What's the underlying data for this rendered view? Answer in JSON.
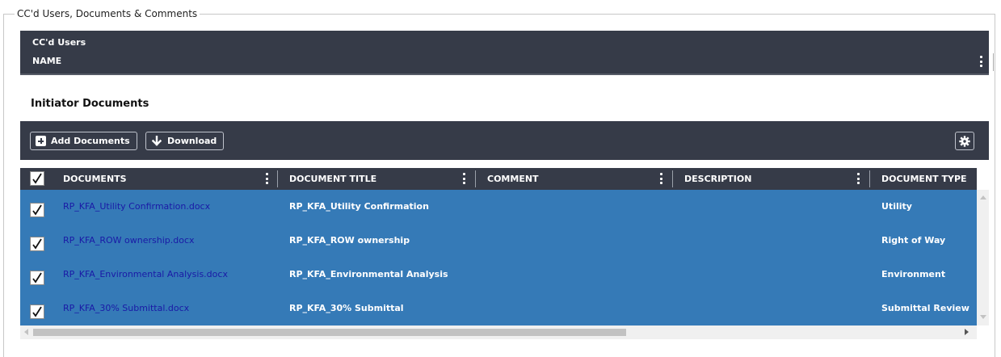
{
  "fieldset": {
    "legend": "CC'd Users, Documents & Comments"
  },
  "cc_users": {
    "title": "CC'd Users",
    "column_name": "NAME"
  },
  "initiator_documents": {
    "title": "Initiator Documents",
    "toolbar": {
      "add_label": "Add Documents",
      "download_label": "Download",
      "settings_icon": "gear-icon"
    },
    "columns": [
      "DOCUMENTS",
      "DOCUMENT TITLE",
      "COMMENT",
      "DESCRIPTION",
      "DOCUMENT TYPE"
    ],
    "rows": [
      {
        "checked": true,
        "document": "RP_KFA_Utility Confirmation.docx",
        "title": "RP_KFA_Utility Confirmation",
        "comment": "",
        "description": "",
        "type": "Utility"
      },
      {
        "checked": true,
        "document": "RP_KFA_ROW ownership.docx",
        "title": "RP_KFA_ROW ownership",
        "comment": "",
        "description": "",
        "type": "Right of Way"
      },
      {
        "checked": true,
        "document": "RP_KFA_Environmental Analysis.docx",
        "title": "RP_KFA_Environmental Analysis",
        "comment": "",
        "description": "",
        "type": "Environment"
      },
      {
        "checked": true,
        "document": "RP_KFA_30% Submittal.docx",
        "title": "RP_KFA_30% Submittal",
        "comment": "",
        "description": "",
        "type": "Submittal Review"
      }
    ],
    "colors": {
      "header_bg": "#363b48",
      "selected_row_bg": "#357ab7",
      "link": "#1a1aa6"
    }
  }
}
